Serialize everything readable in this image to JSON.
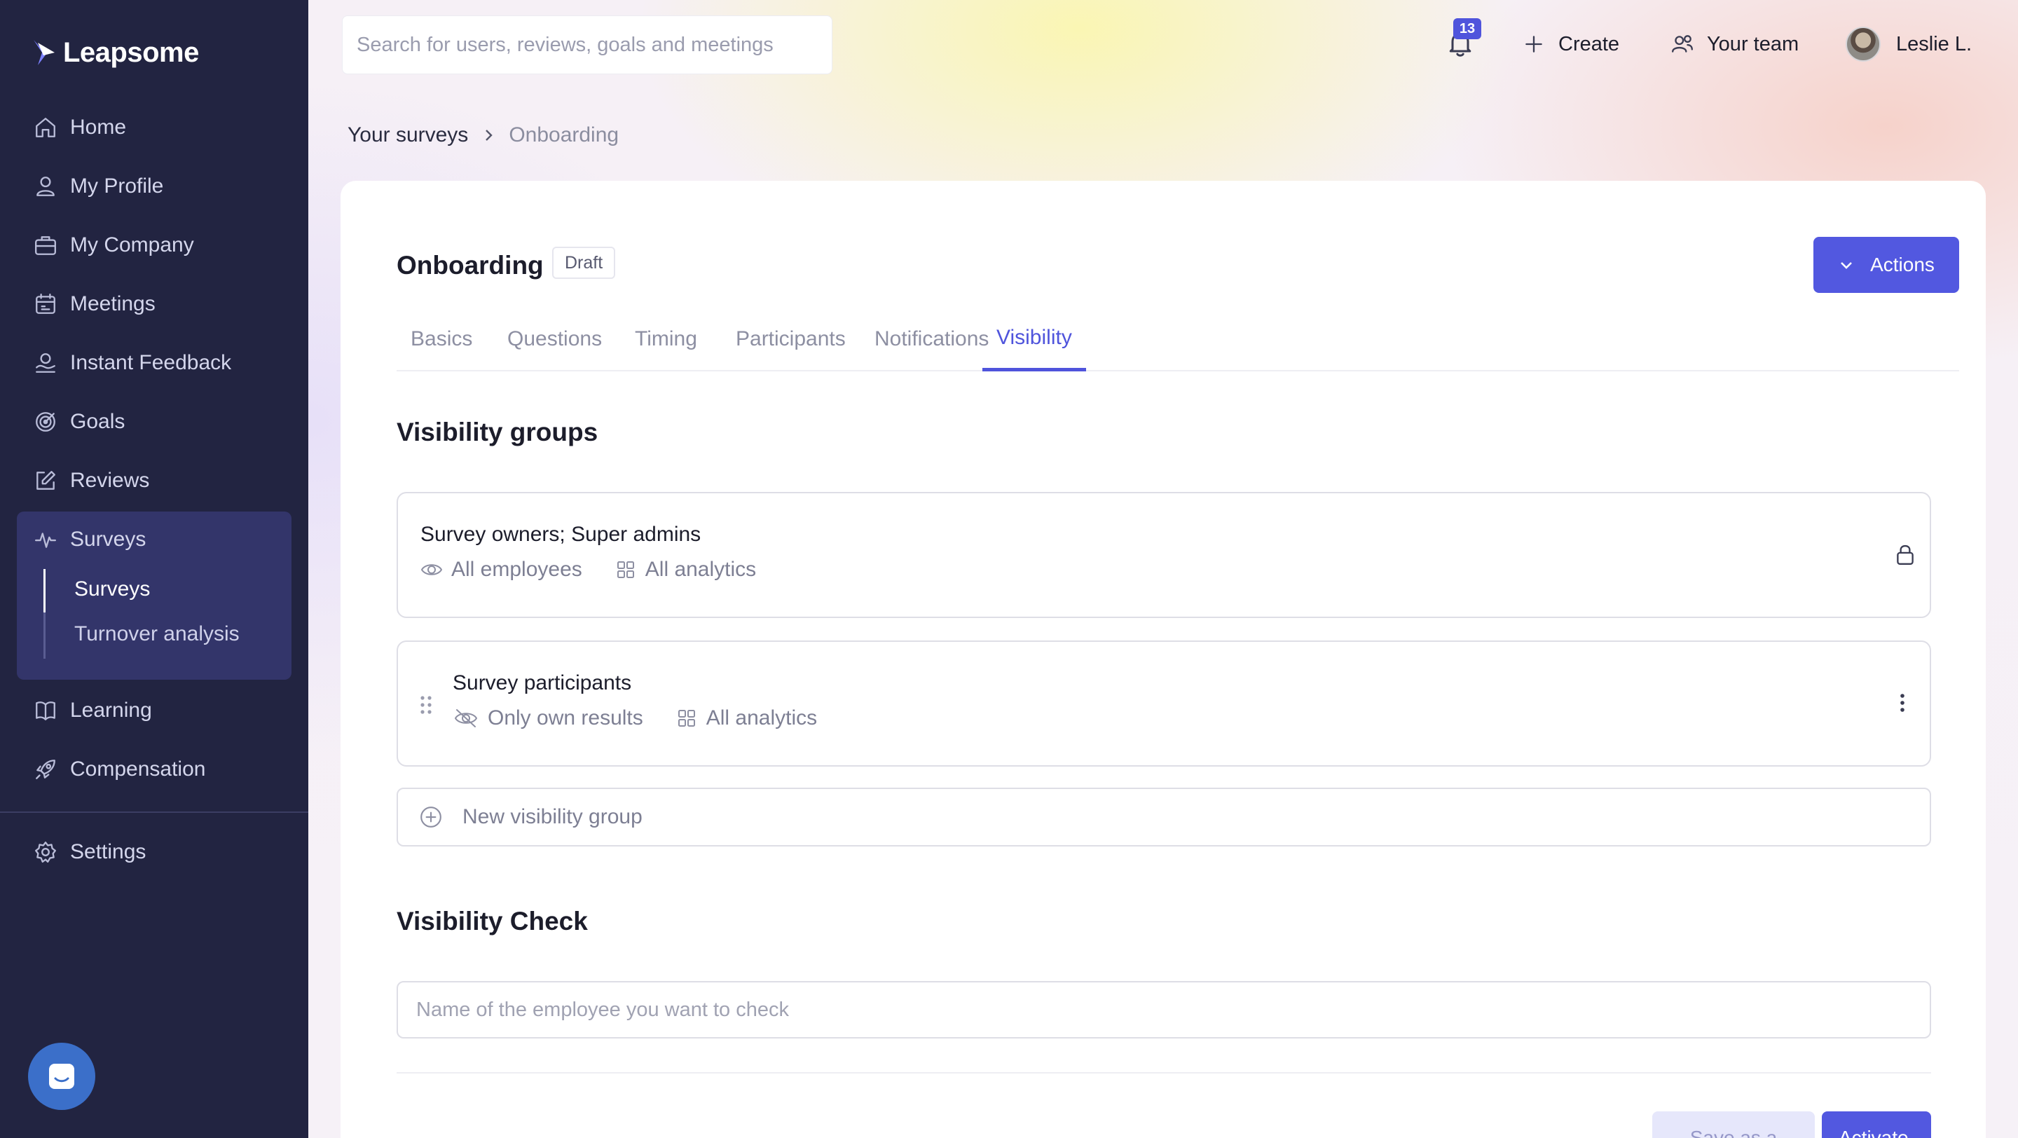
{
  "sidebar": {
    "brand": "Leapsome",
    "nav": [
      {
        "label": "Home",
        "icon": "home-icon"
      },
      {
        "label": "My Profile",
        "icon": "user-icon"
      },
      {
        "label": "My Company",
        "icon": "briefcase-icon"
      },
      {
        "label": "Meetings",
        "icon": "calendar-icon"
      },
      {
        "label": "Instant Feedback",
        "icon": "feedback-icon"
      },
      {
        "label": "Goals",
        "icon": "target-icon"
      },
      {
        "label": "Reviews",
        "icon": "edit-icon"
      },
      {
        "label": "Surveys",
        "icon": "pulse-icon",
        "expanded": true
      },
      {
        "label": "Learning",
        "icon": "book-icon"
      },
      {
        "label": "Compensation",
        "icon": "rocket-icon"
      },
      {
        "label": "Settings",
        "icon": "gear-icon"
      }
    ],
    "surveys_sub": [
      {
        "label": "Surveys",
        "active": true
      },
      {
        "label": "Turnover analysis",
        "active": false
      }
    ]
  },
  "topbar": {
    "search_placeholder": "Search for users, reviews, goals and meetings",
    "notification_count": "13",
    "create_label": "Create",
    "team_label": "Your team",
    "user_name": "Leslie L."
  },
  "breadcrumb": {
    "parent": "Your surveys",
    "current": "Onboarding"
  },
  "survey": {
    "title": "Onboarding",
    "status": "Draft",
    "actions_label": "Actions",
    "tabs": [
      "Basics",
      "Questions",
      "Timing",
      "Participants",
      "Notifications",
      "Visibility"
    ],
    "active_tab": "Visibility"
  },
  "visibility": {
    "section_title": "Visibility groups",
    "groups": [
      {
        "name": "Survey owners; Super admins",
        "scope": "All employees",
        "analytics": "All analytics",
        "locked": true
      },
      {
        "name": "Survey participants",
        "scope": "Only own results",
        "analytics": "All analytics",
        "locked": false
      }
    ],
    "new_group_label": "New visibility group"
  },
  "check": {
    "section_title": "Visibility Check",
    "placeholder": "Name of the employee you want to check"
  },
  "footer": {
    "save_draft_label": "Save as a draft",
    "activate_label": "Activate"
  },
  "colors": {
    "sidebar_bg": "#222441",
    "sidebar_active_bg": "#33356a",
    "accent": "#5258e0",
    "badge": "#4f54dc"
  }
}
